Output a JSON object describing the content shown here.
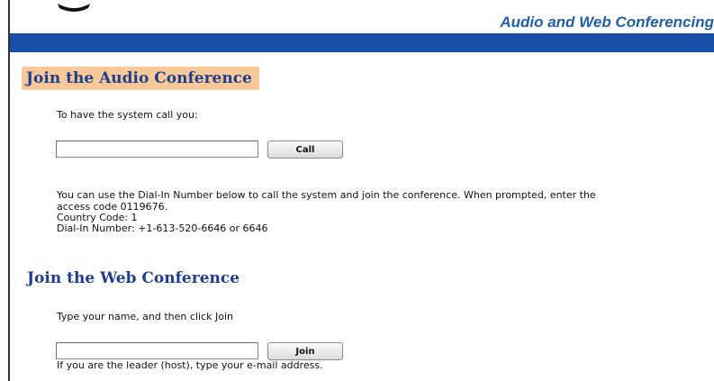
{
  "header": {
    "brand_title": "Audio and Web Conferencing"
  },
  "audio": {
    "heading": "Join the Audio Conference",
    "call_prompt": "To have the system call you:",
    "phone_input_value": "",
    "call_button_label": "Call",
    "dialin_line1": "You can use the Dial-In Number below to call the system and join the conference. When prompted, enter the",
    "dialin_line2": "access code 0119676.",
    "country_code": "Country Code: 1",
    "dialin_number": "Dial-In Number: +1-613-520-6646 or 6646"
  },
  "web": {
    "heading": "Join the Web Conference",
    "name_prompt": "Type your name, and then click Join",
    "name_input_value": "",
    "join_button_label": "Join",
    "leader_hint": "If you are the leader (host), type your e-mail address."
  }
}
